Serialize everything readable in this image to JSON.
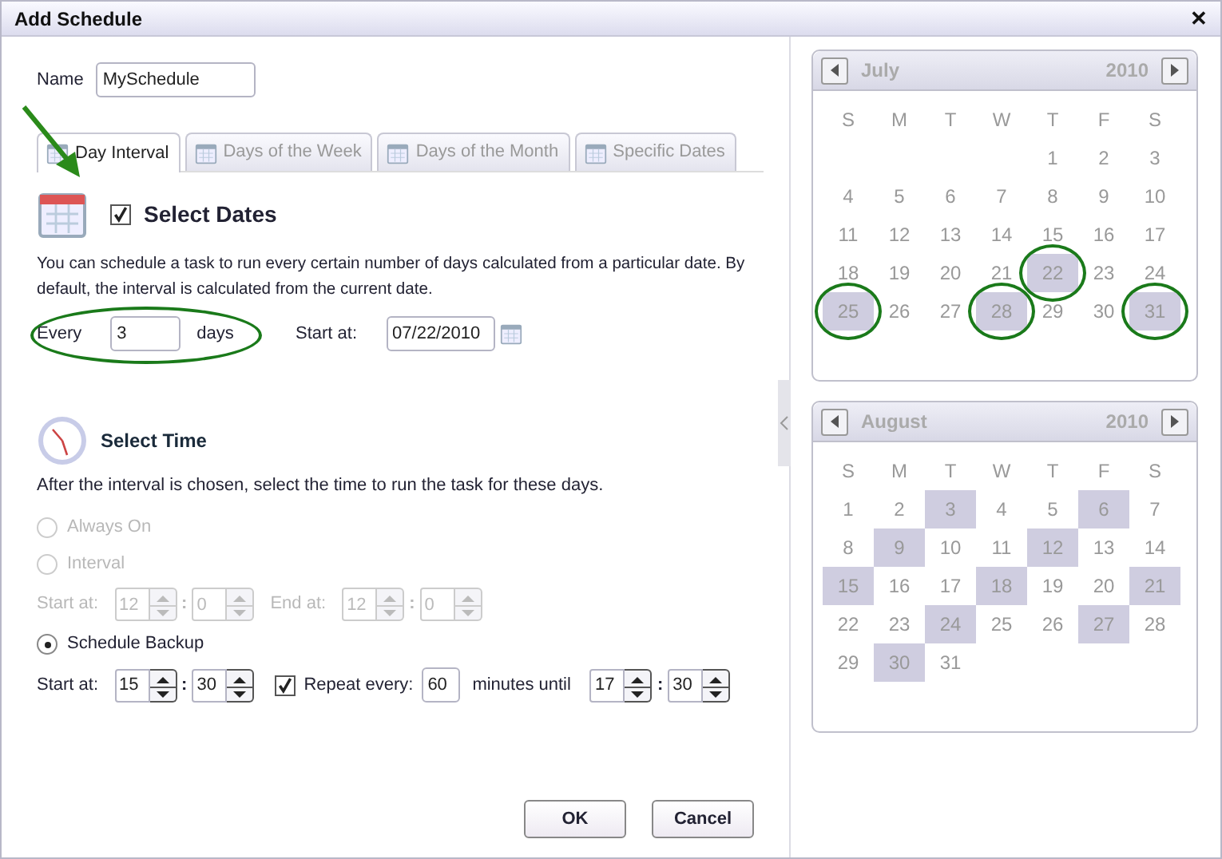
{
  "window": {
    "title": "Add Schedule",
    "close": "✕"
  },
  "name_field": {
    "label": "Name",
    "value": "MySchedule"
  },
  "tabs": [
    {
      "label": "Day Interval",
      "selected": true,
      "pointed": true
    },
    {
      "label": "Days of the Week",
      "selected": false,
      "pointed": false
    },
    {
      "label": "Days of the Month",
      "selected": false,
      "pointed": false
    },
    {
      "label": "Specific Dates",
      "selected": false,
      "pointed": false
    }
  ],
  "select_dates": {
    "title": "Select Dates",
    "checked": true,
    "description": "You can schedule a task to run every certain number of days calculated from a particular date. By default, the interval is calculated from the current date.",
    "every_label": "Every",
    "every_value": "3",
    "days_label": "days",
    "circled": true,
    "start_label": "Start at:",
    "start_value": "07/22/2010"
  },
  "select_time": {
    "title": "Select Time",
    "description": "After the interval is chosen, select the time to run the task for these days.",
    "options": [
      {
        "kind": "radio",
        "label": "Always On",
        "selected": false,
        "disabled": true
      },
      {
        "kind": "radio",
        "label": "Interval",
        "selected": false,
        "disabled": true
      },
      {
        "kind": "range",
        "disabled": true,
        "start_label": "Start at:",
        "start_hour": "12",
        "start_minute": "0",
        "end_label": "End at:",
        "end_hour": "12",
        "end_minute": "0"
      },
      {
        "kind": "radio",
        "label": "Schedule Backup",
        "selected": true,
        "disabled": false
      },
      {
        "kind": "repeat",
        "disabled": false,
        "start_label": "Start at:",
        "start_hour": "15",
        "start_minute": "30",
        "repeat_checked": true,
        "repeat_label": "Repeat every:",
        "repeat_value": "60",
        "until_label": "minutes until",
        "end_hour": "17",
        "end_minute": "30"
      }
    ],
    "separator": ":"
  },
  "calendars": [
    {
      "month": "July",
      "year": "2010",
      "weekdays": [
        "S",
        "M",
        "T",
        "W",
        "T",
        "F",
        "S"
      ],
      "weeks": [
        [
          {
            "d": "1",
            "selected": false,
            "circled": false
          },
          {
            "d": "2",
            "selected": false,
            "circled": false
          },
          {
            "d": "3",
            "selected": false,
            "circled": false
          }
        ],
        [
          {
            "d": "4",
            "selected": false,
            "circled": false
          },
          {
            "d": "5",
            "selected": false,
            "circled": false
          },
          {
            "d": "6",
            "selected": false,
            "circled": false
          },
          {
            "d": "7",
            "selected": false,
            "circled": false
          },
          {
            "d": "8",
            "selected": false,
            "circled": false
          },
          {
            "d": "9",
            "selected": false,
            "circled": false
          },
          {
            "d": "10",
            "selected": false,
            "circled": false
          }
        ],
        [
          {
            "d": "11",
            "selected": false,
            "circled": false
          },
          {
            "d": "12",
            "selected": false,
            "circled": false
          },
          {
            "d": "13",
            "selected": false,
            "circled": false
          },
          {
            "d": "14",
            "selected": false,
            "circled": false
          },
          {
            "d": "15",
            "selected": false,
            "circled": false
          },
          {
            "d": "16",
            "selected": false,
            "circled": false
          },
          {
            "d": "17",
            "selected": false,
            "circled": false
          }
        ],
        [
          {
            "d": "18",
            "selected": false,
            "circled": false
          },
          {
            "d": "19",
            "selected": false,
            "circled": false
          },
          {
            "d": "20",
            "selected": false,
            "circled": false
          },
          {
            "d": "21",
            "selected": false,
            "circled": false
          },
          {
            "d": "22",
            "selected": true,
            "circled": true
          },
          {
            "d": "23",
            "selected": false,
            "circled": false
          },
          {
            "d": "24",
            "selected": false,
            "circled": false
          }
        ],
        [
          {
            "d": "25",
            "selected": true,
            "circled": true
          },
          {
            "d": "26",
            "selected": false,
            "circled": false
          },
          {
            "d": "27",
            "selected": false,
            "circled": false
          },
          {
            "d": "28",
            "selected": true,
            "circled": true
          },
          {
            "d": "29",
            "selected": false,
            "circled": false
          },
          {
            "d": "30",
            "selected": false,
            "circled": false
          },
          {
            "d": "31",
            "selected": true,
            "circled": true
          }
        ]
      ]
    },
    {
      "month": "August",
      "year": "2010",
      "weekdays": [
        "S",
        "M",
        "T",
        "W",
        "T",
        "F",
        "S"
      ],
      "weeks": [
        [
          {
            "d": "1",
            "selected": false,
            "circled": false
          },
          {
            "d": "2",
            "selected": false,
            "circled": false
          },
          {
            "d": "3",
            "selected": true,
            "circled": false
          },
          {
            "d": "4",
            "selected": false,
            "circled": false
          },
          {
            "d": "5",
            "selected": false,
            "circled": false
          },
          {
            "d": "6",
            "selected": true,
            "circled": false
          },
          {
            "d": "7",
            "selected": false,
            "circled": false
          }
        ],
        [
          {
            "d": "8",
            "selected": false,
            "circled": false
          },
          {
            "d": "9",
            "selected": true,
            "circled": false
          },
          {
            "d": "10",
            "selected": false,
            "circled": false
          },
          {
            "d": "11",
            "selected": false,
            "circled": false
          },
          {
            "d": "12",
            "selected": true,
            "circled": false
          },
          {
            "d": "13",
            "selected": false,
            "circled": false
          },
          {
            "d": "14",
            "selected": false,
            "circled": false
          }
        ],
        [
          {
            "d": "15",
            "selected": true,
            "circled": false
          },
          {
            "d": "16",
            "selected": false,
            "circled": false
          },
          {
            "d": "17",
            "selected": false,
            "circled": false
          },
          {
            "d": "18",
            "selected": true,
            "circled": false
          },
          {
            "d": "19",
            "selected": false,
            "circled": false
          },
          {
            "d": "20",
            "selected": false,
            "circled": false
          },
          {
            "d": "21",
            "selected": true,
            "circled": false
          }
        ],
        [
          {
            "d": "22",
            "selected": false,
            "circled": false
          },
          {
            "d": "23",
            "selected": false,
            "circled": false
          },
          {
            "d": "24",
            "selected": true,
            "circled": false
          },
          {
            "d": "25",
            "selected": false,
            "circled": false
          },
          {
            "d": "26",
            "selected": false,
            "circled": false
          },
          {
            "d": "27",
            "selected": true,
            "circled": false
          },
          {
            "d": "28",
            "selected": false,
            "circled": false
          }
        ],
        [
          {
            "d": "29",
            "selected": false,
            "circled": false
          },
          {
            "d": "30",
            "selected": true,
            "circled": false
          },
          {
            "d": "31",
            "selected": false,
            "circled": false
          }
        ]
      ]
    }
  ],
  "buttons": [
    {
      "label": "OK"
    },
    {
      "label": "Cancel"
    }
  ]
}
